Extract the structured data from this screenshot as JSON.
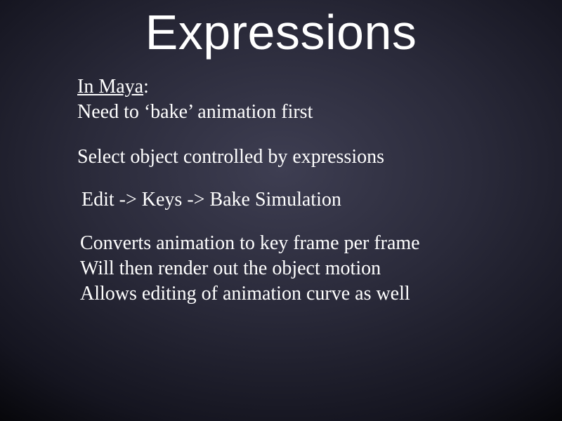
{
  "title": "Expressions",
  "section1": {
    "heading_underlined": "In Maya",
    "heading_rest": ":",
    "line2": "Need to ‘bake’ animation first"
  },
  "section2": {
    "line1": "Select object controlled by expressions"
  },
  "section3": {
    "line1": "Edit -> Keys -> Bake Simulation"
  },
  "section4": {
    "line1": "Converts animation to key frame per frame",
    "line2": "Will then render out the object motion",
    "line3": "Allows editing of animation curve as well"
  }
}
